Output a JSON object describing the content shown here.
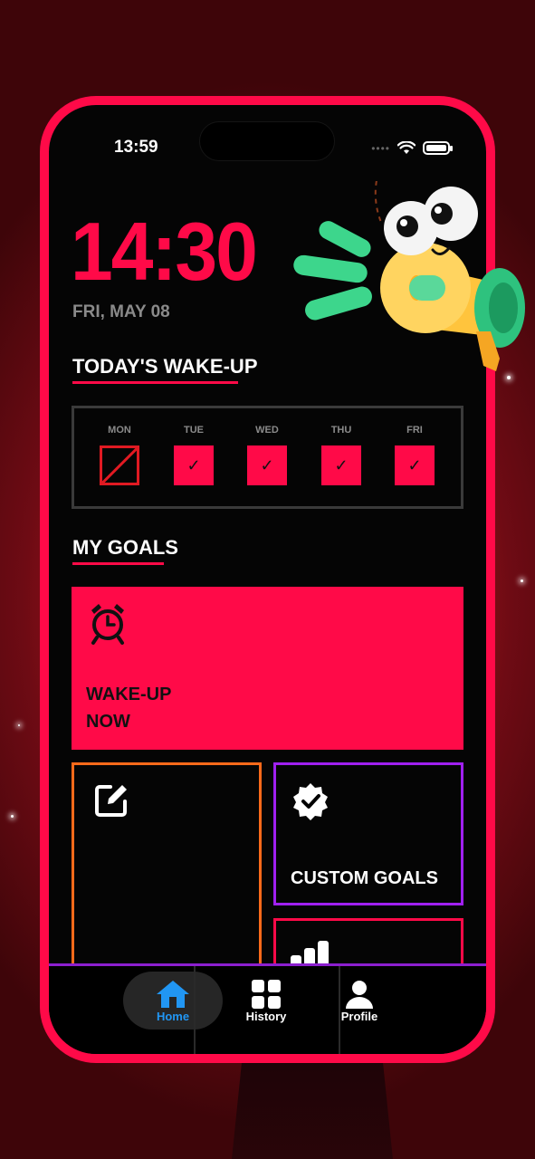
{
  "status_bar": {
    "time": "13:59",
    "signal_dots": "••••"
  },
  "clock": {
    "time": "14:30",
    "date": "FRI, MAY 08"
  },
  "wakeup": {
    "title": "TODAY'S WAKE-UP",
    "days": [
      {
        "label": "MON",
        "status": "missed",
        "mark": ""
      },
      {
        "label": "TUE",
        "status": "done",
        "mark": "✓"
      },
      {
        "label": "WED",
        "status": "done",
        "mark": "✓"
      },
      {
        "label": "THU",
        "status": "done",
        "mark": "✓"
      },
      {
        "label": "FRI",
        "status": "done",
        "mark": "✓"
      }
    ]
  },
  "goals": {
    "title": "MY GOALS",
    "wake_label_line1": "WAKE-UP",
    "wake_label_line2": "NOW",
    "custom_label": "CUSTOM GOALS"
  },
  "nav": {
    "home": "Home",
    "history": "History",
    "profile": "Profile",
    "active": "home"
  },
  "colors": {
    "accent": "#ff0a48",
    "missed": "#e01a22",
    "edit_border": "#ff6a1a",
    "custom_border": "#a020f0",
    "nav_active": "#2196f3"
  }
}
